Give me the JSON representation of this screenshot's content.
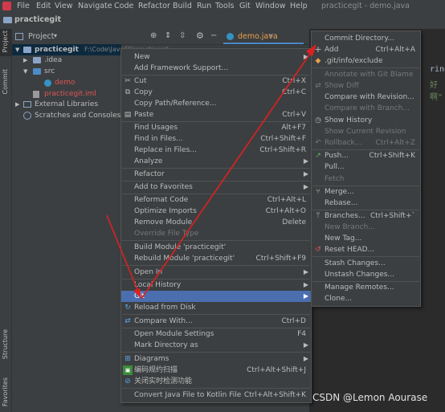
{
  "menubar": {
    "items": [
      "File",
      "Edit",
      "View",
      "Navigate",
      "Code",
      "Refactor",
      "Build",
      "Run",
      "Tools",
      "Git",
      "Window",
      "Help"
    ],
    "title": "practicegit - demo.java"
  },
  "breadcrumb": "practicegit",
  "toolbar": {
    "project_label": "Project",
    "tab_label": "demo.java"
  },
  "sidebar": {
    "project": "Project",
    "commit": "Commit",
    "structure": "Structure",
    "favorites": "Favorites"
  },
  "tree": {
    "root": "practicegit",
    "root_path": "F:\\Code\\JavaSE\\practicegit",
    "items": [
      {
        "label": ".idea"
      },
      {
        "label": "src"
      },
      {
        "label": "demo"
      },
      {
        "label": "practicegit.iml"
      },
      {
        "label": "External Libraries"
      },
      {
        "label": "Scratches and Consoles"
      }
    ]
  },
  "editor": {
    "frag1": "ring[",
    "frag2": "好啊\""
  },
  "context_menu": {
    "items": [
      {
        "label": "New",
        "shortcut": "",
        "submenu": true
      },
      {
        "label": "Add Framework Support...",
        "shortcut": ""
      },
      {
        "label": "Cut",
        "shortcut": "Ctrl+X",
        "icon": "cut-icon"
      },
      {
        "label": "Copy",
        "shortcut": "Ctrl+C",
        "icon": "copy-icon"
      },
      {
        "label": "Copy Path/Reference...",
        "shortcut": ""
      },
      {
        "label": "Paste",
        "shortcut": "Ctrl+V",
        "icon": "paste-icon"
      },
      {
        "label": "Find Usages",
        "shortcut": "Alt+F7"
      },
      {
        "label": "Find in Files...",
        "shortcut": "Ctrl+Shift+F"
      },
      {
        "label": "Replace in Files...",
        "shortcut": "Ctrl+Shift+R"
      },
      {
        "label": "Analyze",
        "shortcut": "",
        "submenu": true
      },
      {
        "label": "Refactor",
        "shortcut": "",
        "submenu": true
      },
      {
        "label": "Add to Favorites",
        "shortcut": "",
        "submenu": true
      },
      {
        "label": "Reformat Code",
        "shortcut": "Ctrl+Alt+L"
      },
      {
        "label": "Optimize Imports",
        "shortcut": "Ctrl+Alt+O"
      },
      {
        "label": "Remove Module",
        "shortcut": "Delete"
      },
      {
        "label": "Override File Type",
        "shortcut": "",
        "disabled": true
      },
      {
        "label": "Build Module 'practicegit'",
        "shortcut": ""
      },
      {
        "label": "Rebuild Module 'practicegit'",
        "shortcut": "Ctrl+Shift+F9"
      },
      {
        "label": "Open In",
        "shortcut": "",
        "submenu": true
      },
      {
        "label": "Local History",
        "shortcut": "",
        "submenu": true
      },
      {
        "label": "Git",
        "shortcut": "",
        "submenu": true,
        "highlighted": true
      },
      {
        "label": "Reload from Disk",
        "shortcut": "",
        "icon": "reload-icon"
      },
      {
        "label": "Compare With...",
        "shortcut": "Ctrl+D",
        "icon": "compare-icon"
      },
      {
        "label": "Open Module Settings",
        "shortcut": "F4"
      },
      {
        "label": "Mark Directory as",
        "shortcut": "",
        "submenu": true
      },
      {
        "label": "Diagrams",
        "shortcut": "",
        "submenu": true,
        "icon": "diagram-icon"
      },
      {
        "label": "编码规约扫描",
        "shortcut": "Ctrl+Alt+Shift+J",
        "icon": "scan-icon"
      },
      {
        "label": "关闭实时检测功能",
        "shortcut": "",
        "icon": "block-icon"
      },
      {
        "label": "Convert Java File to Kotlin File",
        "shortcut": "Ctrl+Alt+Shift+K"
      }
    ]
  },
  "git_menu": {
    "items": [
      {
        "label": "Commit Directory...",
        "shortcut": ""
      },
      {
        "label": "Add",
        "shortcut": "Ctrl+Alt+A",
        "icon": "plus-icon"
      },
      {
        "label": ".git/info/exclude",
        "shortcut": "",
        "icon": "git-file-icon"
      },
      {
        "label": "Annotate with Git Blame",
        "shortcut": "",
        "disabled": true
      },
      {
        "label": "Show Diff",
        "shortcut": "",
        "disabled": true,
        "icon": "diff-icon"
      },
      {
        "label": "Compare with Revision...",
        "shortcut": ""
      },
      {
        "label": "Compare with Branch...",
        "shortcut": "",
        "disabled": true
      },
      {
        "label": "Show History",
        "shortcut": "",
        "icon": "history-icon"
      },
      {
        "label": "Show Current Revision",
        "shortcut": "",
        "disabled": true
      },
      {
        "label": "Rollback...",
        "shortcut": "Ctrl+Alt+Z",
        "disabled": true,
        "icon": "rollback-icon"
      },
      {
        "label": "Push...",
        "shortcut": "Ctrl+Shift+K",
        "icon": "push-icon"
      },
      {
        "label": "Pull...",
        "shortcut": ""
      },
      {
        "label": "Fetch",
        "shortcut": "",
        "disabled": true
      },
      {
        "label": "Merge...",
        "shortcut": "",
        "icon": "merge-icon"
      },
      {
        "label": "Rebase...",
        "shortcut": ""
      },
      {
        "label": "Branches...",
        "shortcut": "Ctrl+Shift+`",
        "icon": "branch-icon"
      },
      {
        "label": "New Branch...",
        "shortcut": "",
        "disabled": true
      },
      {
        "label": "New Tag...",
        "shortcut": ""
      },
      {
        "label": "Reset HEAD...",
        "shortcut": "",
        "icon": "reset-icon"
      },
      {
        "label": "Stash Changes...",
        "shortcut": ""
      },
      {
        "label": "Unstash Changes...",
        "shortcut": ""
      },
      {
        "label": "Manage Remotes...",
        "shortcut": ""
      },
      {
        "label": "Clone...",
        "shortcut": ""
      }
    ]
  },
  "watermark": "CSDN @Lemon Aourase",
  "colors": {
    "highlight": "#4b6eaf",
    "arrow": "#e02020",
    "orange": "#e8a04c"
  }
}
